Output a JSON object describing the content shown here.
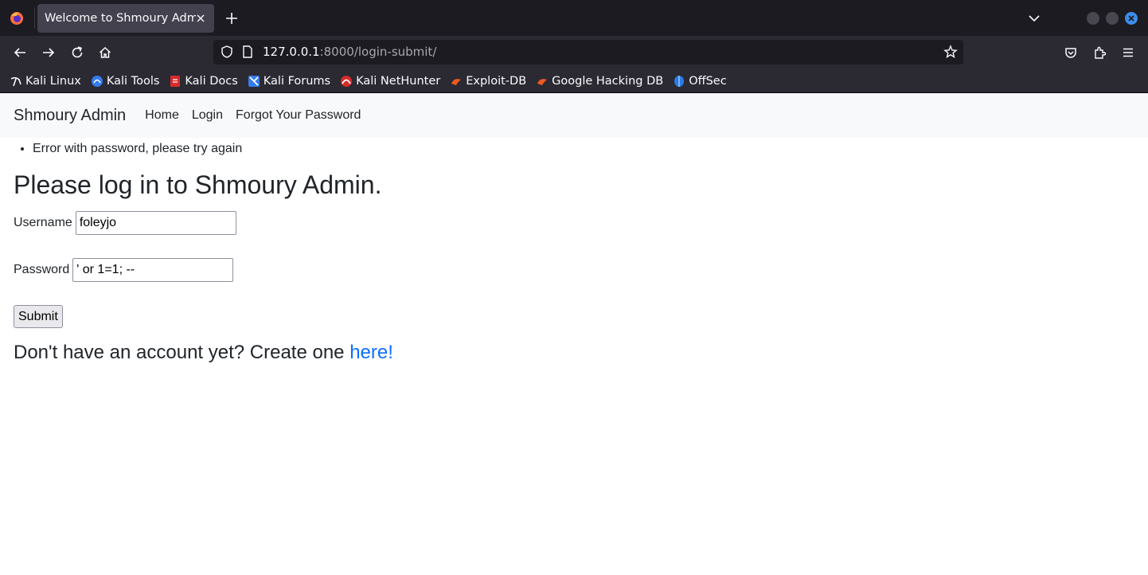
{
  "browser": {
    "tab_title": "Welcome to Shmoury Admin!",
    "url_host": "127.0.0.1",
    "url_rest": ":8000/login-submit/",
    "bookmarks": [
      {
        "label": "Kali Linux",
        "icon": "kali-dragon-icon"
      },
      {
        "label": "Kali Tools",
        "icon": "kali-tools-icon"
      },
      {
        "label": "Kali Docs",
        "icon": "kali-docs-icon"
      },
      {
        "label": "Kali Forums",
        "icon": "kali-forums-icon"
      },
      {
        "label": "Kali NetHunter",
        "icon": "kali-nethunter-icon"
      },
      {
        "label": "Exploit-DB",
        "icon": "exploit-db-icon"
      },
      {
        "label": "Google Hacking DB",
        "icon": "ghdb-icon"
      },
      {
        "label": "OffSec",
        "icon": "offsec-icon"
      }
    ],
    "colors": {
      "tabbar": "#1c1b22",
      "toolbar": "#2b2a33",
      "active_tab": "#42414d",
      "close_accent": "#3b8dea"
    }
  },
  "site": {
    "brand": "Shmoury Admin",
    "nav": [
      "Home",
      "Login",
      "Forgot Your Password"
    ],
    "messages": [
      "Error with password, please try again"
    ],
    "heading": "Please log in to Shmoury Admin.",
    "form": {
      "username_label": "Username",
      "username_value": "foleyjo",
      "password_label": "Password",
      "password_value": "' or 1=1; --",
      "submit_label": "Submit"
    },
    "signup_text": "Don't have an account yet? Create one ",
    "signup_link": "here!",
    "link_color": "#0d6efd"
  }
}
